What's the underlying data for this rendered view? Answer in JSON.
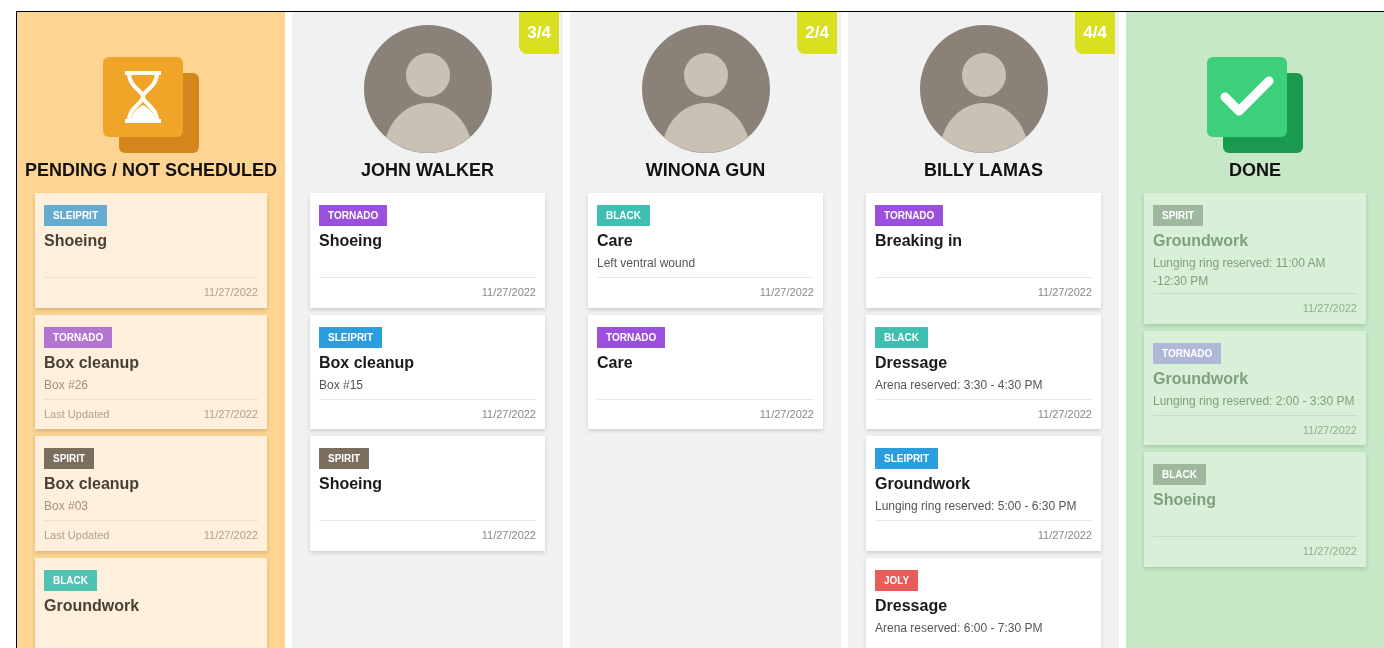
{
  "columns": [
    {
      "kind": "pending",
      "title": "PENDING / NOT SCHEDULED",
      "cards": [
        {
          "tag": {
            "label": "SLEIPRIT",
            "color": "#66acd0"
          },
          "title": "Shoeing",
          "date": "11/27/2022"
        },
        {
          "tag": {
            "label": "TORNADO",
            "color": "#b276d0"
          },
          "title": "Box cleanup",
          "note": "Box #26",
          "updated": "Last Updated",
          "date": "11/27/2022"
        },
        {
          "tag": {
            "label": "SPIRIT",
            "color": "#7a6f5f"
          },
          "title": "Box cleanup",
          "note": "Box #03",
          "updated": "Last Updated",
          "date": "11/27/2022"
        },
        {
          "tag": {
            "label": "BLACK",
            "color": "#4fc2b2"
          },
          "title": "Groundwork"
        }
      ]
    },
    {
      "kind": "person",
      "title": "JOHN WALKER",
      "count": "3/4",
      "cards": [
        {
          "tag": {
            "label": "TORNADO",
            "color": "#9b4fdd"
          },
          "title": "Shoeing",
          "date": "11/27/2022"
        },
        {
          "tag": {
            "label": "SLEIPRIT",
            "color": "#2b9ee0"
          },
          "title": "Box cleanup",
          "note": "Box #15",
          "date": "11/27/2022"
        },
        {
          "tag": {
            "label": "SPIRIT",
            "color": "#7b6e5e"
          },
          "title": "Shoeing",
          "date": "11/27/2022"
        }
      ]
    },
    {
      "kind": "person",
      "title": "WINONA GUN",
      "count": "2/4",
      "cards": [
        {
          "tag": {
            "label": "BLACK",
            "color": "#3fbfb1"
          },
          "title": "Care",
          "note": "Left ventral wound",
          "date": "11/27/2022"
        },
        {
          "tag": {
            "label": "TORNADO",
            "color": "#9b4fdd"
          },
          "title": "Care",
          "date": "11/27/2022"
        }
      ]
    },
    {
      "kind": "person",
      "title": "BILLY LAMAS",
      "count": "4/4",
      "cards": [
        {
          "tag": {
            "label": "TORNADO",
            "color": "#9b4fdd"
          },
          "title": "Breaking in",
          "date": "11/27/2022"
        },
        {
          "tag": {
            "label": "BLACK",
            "color": "#3fbfb1"
          },
          "title": "Dressage",
          "note": "Arena reserved: 3:30 - 4:30 PM",
          "date": "11/27/2022"
        },
        {
          "tag": {
            "label": "SLEIPRIT",
            "color": "#2b9ee0"
          },
          "title": "Groundwork",
          "note": "Lunging ring reserved: 5:00 - 6:30 PM",
          "date": "11/27/2022"
        },
        {
          "tag": {
            "label": "JOLY",
            "color": "#e85c5c"
          },
          "title": "Dressage",
          "note": "Arena reserved: 6:00 - 7:30 PM"
        }
      ]
    },
    {
      "kind": "done",
      "title": "DONE",
      "cards": [
        {
          "tag": {
            "label": "SPIRIT",
            "color": "#9db89d"
          },
          "title": "Groundwork",
          "note": "Lunging ring reserved: 11:00 AM -12:30 PM",
          "date": "11/27/2022"
        },
        {
          "tag": {
            "label": "TORNADO",
            "color": "#b0b8d8"
          },
          "title": "Groundwork",
          "note": "Lunging ring reserved: 2:00 - 3:30 PM",
          "date": "11/27/2022"
        },
        {
          "tag": {
            "label": "BLACK",
            "color": "#9db89d"
          },
          "title": "Shoeing",
          "date": "11/27/2022"
        }
      ]
    }
  ]
}
